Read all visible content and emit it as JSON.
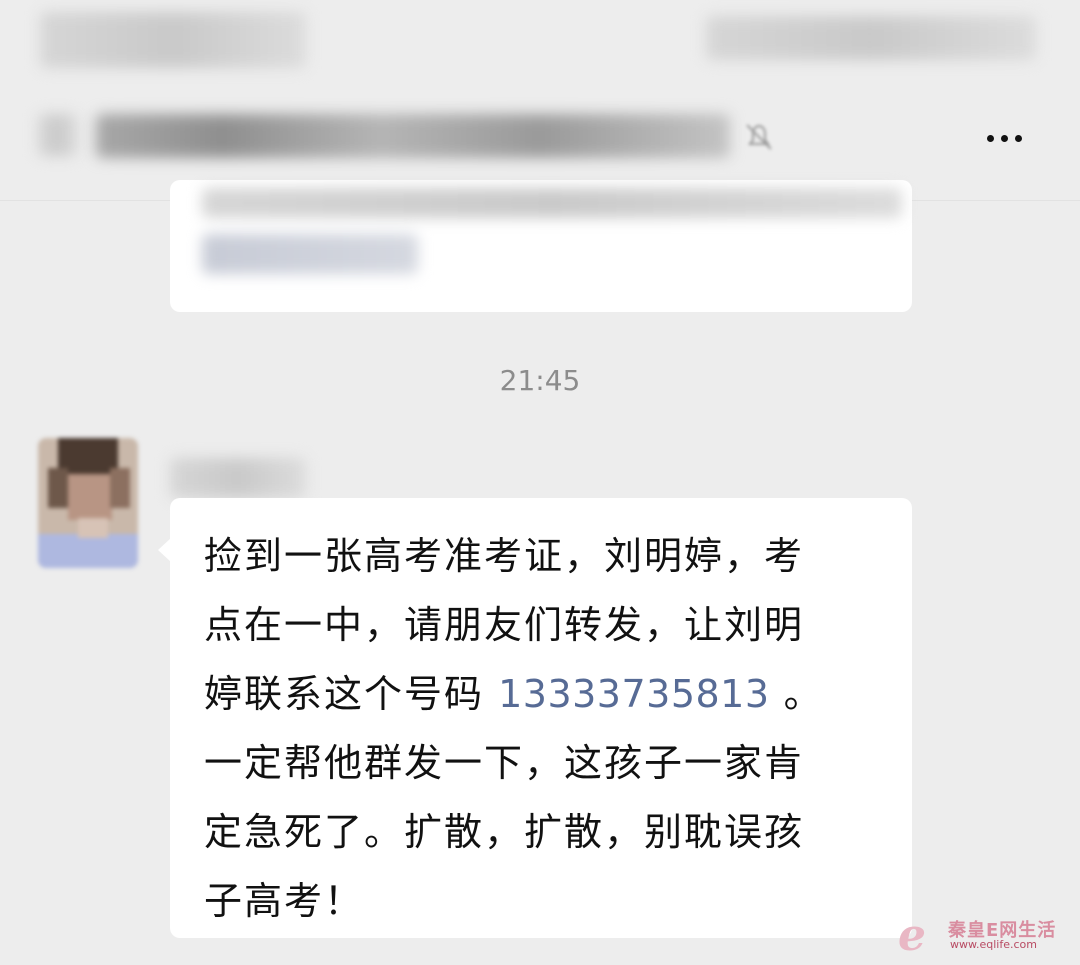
{
  "header": {
    "more_icon": "more-horizontal-icon"
  },
  "chat": {
    "timestamp": "21:45",
    "message": {
      "lines": [
        "捡到一张高考准考证，刘明婷，考",
        "点在一中，请朋友们转发，让刘明"
      ],
      "line3_prefix": "婷联系这个号码 ",
      "phone": "13333735813",
      "line3_suffix": " 。",
      "lines_after": [
        "一定帮他群发一下，这孩子一家肯",
        "定急死了。扩散，扩散，别耽误孩",
        "子高考！"
      ]
    }
  },
  "watermark": {
    "logo_letter": "e",
    "title": "秦皇E网生活",
    "url": "www.eqlife.com"
  },
  "colors": {
    "background": "#ededed",
    "bubble": "#ffffff",
    "link": "#576b95",
    "text": "#111111",
    "timestamp": "#8c8c8c"
  }
}
